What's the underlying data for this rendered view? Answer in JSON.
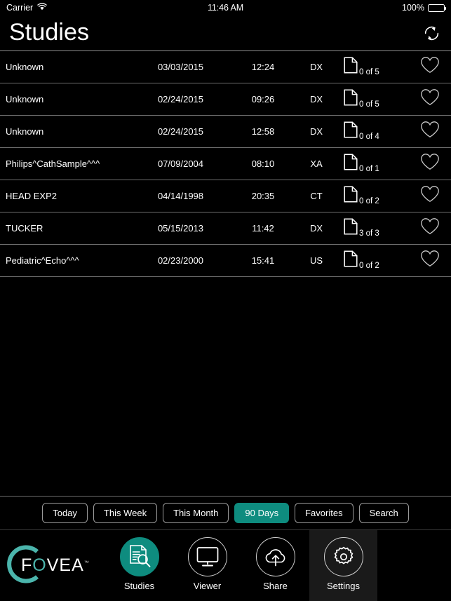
{
  "statusbar": {
    "carrier": "Carrier",
    "wifi_icon": "wifi-icon",
    "time": "11:46 AM",
    "battery_percent": "100%",
    "battery_icon": "battery-full-icon"
  },
  "header": {
    "title": "Studies",
    "refresh_icon": "refresh-icon"
  },
  "colors": {
    "accent": "#0e8c7f",
    "background": "#000000",
    "separator": "#6f6f6f",
    "text": "#ffffff"
  },
  "studies": [
    {
      "name": "Unknown",
      "date": "03/03/2015",
      "time": "12:24",
      "modality": "DX",
      "count": "0 of 5",
      "doc_icon": "document-icon",
      "favorite_icon": "heart-outline-icon",
      "favorite": false
    },
    {
      "name": "Unknown",
      "date": "02/24/2015",
      "time": "09:26",
      "modality": "DX",
      "count": "0 of 5",
      "doc_icon": "document-icon",
      "favorite_icon": "heart-outline-icon",
      "favorite": false
    },
    {
      "name": "Unknown",
      "date": "02/24/2015",
      "time": "12:58",
      "modality": "DX",
      "count": "0 of 4",
      "doc_icon": "document-icon",
      "favorite_icon": "heart-outline-icon",
      "favorite": false
    },
    {
      "name": "Philips^CathSample^^^",
      "date": "07/09/2004",
      "time": "08:10",
      "modality": "XA",
      "count": "0 of 1",
      "doc_icon": "document-icon",
      "favorite_icon": "heart-outline-icon",
      "favorite": false
    },
    {
      "name": "HEAD EXP2",
      "date": "04/14/1998",
      "time": "20:35",
      "modality": "CT",
      "count": "0 of 2",
      "doc_icon": "document-icon",
      "favorite_icon": "heart-outline-icon",
      "favorite": false
    },
    {
      "name": "TUCKER",
      "date": "05/15/2013",
      "time": "11:42",
      "modality": "DX",
      "count": "3 of 3",
      "doc_icon": "document-icon",
      "favorite_icon": "heart-outline-icon",
      "favorite": false
    },
    {
      "name": "Pediatric^Echo^^^",
      "date": "02/23/2000",
      "time": "15:41",
      "modality": "US",
      "count": "0 of 2",
      "doc_icon": "document-icon",
      "favorite_icon": "heart-outline-icon",
      "favorite": false
    }
  ],
  "filters": [
    {
      "label": "Today",
      "active": false
    },
    {
      "label": "This Week",
      "active": false
    },
    {
      "label": "This Month",
      "active": false
    },
    {
      "label": "90 Days",
      "active": true
    },
    {
      "label": "Favorites",
      "active": false
    },
    {
      "label": "Search",
      "active": false
    }
  ],
  "logo": {
    "letter_f": "F",
    "letter_o": "O",
    "rest": "VEA",
    "trademark": "™"
  },
  "tabs": [
    {
      "label": "Studies",
      "icon": "document-search-icon",
      "active": true,
      "highlighted": false
    },
    {
      "label": "Viewer",
      "icon": "monitor-icon",
      "active": false,
      "highlighted": false
    },
    {
      "label": "Share",
      "icon": "cloud-upload-icon",
      "active": false,
      "highlighted": false
    },
    {
      "label": "Settings",
      "icon": "gear-icon",
      "active": false,
      "highlighted": true
    }
  ]
}
